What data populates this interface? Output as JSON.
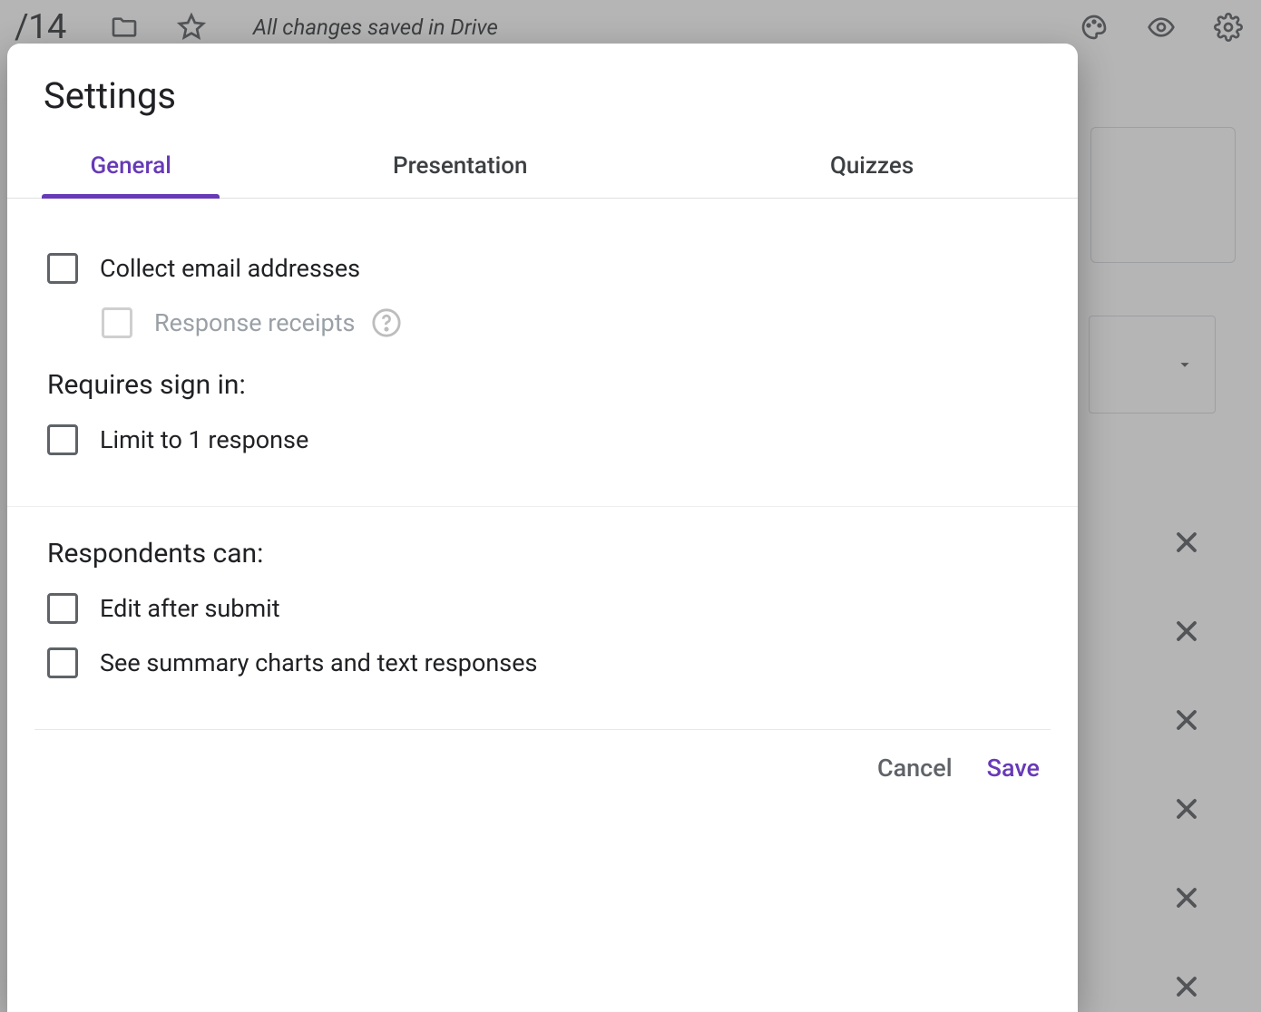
{
  "topbar": {
    "title_fragment": "/14",
    "status": "All changes saved in Drive"
  },
  "modal": {
    "title": "Settings",
    "tabs": [
      {
        "label": "General",
        "active": true
      },
      {
        "label": "Presentation",
        "active": false
      },
      {
        "label": "Quizzes",
        "active": false
      }
    ],
    "general": {
      "collect_email": "Collect email addresses",
      "response_receipts": "Response receipts",
      "requires_sign_in_header": "Requires sign in:",
      "limit_one_response": "Limit to 1 response",
      "respondents_can_header": "Respondents can:",
      "edit_after_submit": "Edit after submit",
      "see_summary": "See summary charts and text responses"
    },
    "footer": {
      "cancel": "Cancel",
      "save": "Save"
    }
  }
}
